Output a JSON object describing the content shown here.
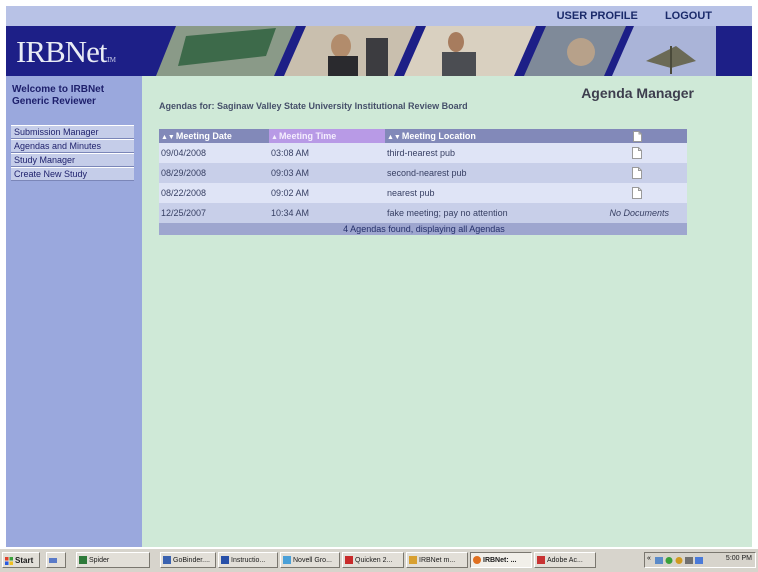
{
  "header": {
    "nav": [
      "USER PROFILE",
      "LOGOUT"
    ],
    "logo": "IRBNet",
    "logo_tm": "TM"
  },
  "sidebar": {
    "welcome_line1": "Welcome to IRBNet",
    "welcome_line2": "Generic Reviewer",
    "menu": [
      "Submission Manager",
      "Agendas and Minutes",
      "Study Manager",
      "Create New Study"
    ]
  },
  "main": {
    "title": "Agenda Manager",
    "agendas_for": "Agendas for: Saginaw Valley State University Institutional Review Board",
    "table": {
      "columns": [
        "Meeting Date",
        "Meeting Time",
        "Meeting Location",
        ""
      ],
      "sorted_column": 1,
      "rows": [
        {
          "date": "09/04/2008",
          "time": "03:08 AM",
          "location": "third-nearest pub",
          "docs": ""
        },
        {
          "date": "08/29/2008",
          "time": "09:03 AM",
          "location": "second-nearest pub",
          "docs": ""
        },
        {
          "date": "08/22/2008",
          "time": "09:02 AM",
          "location": "nearest pub",
          "docs": ""
        },
        {
          "date": "12/25/2007",
          "time": "10:34 AM",
          "location": "fake meeting; pay no attention",
          "docs": "No Documents"
        }
      ],
      "footer": "4 Agendas found, displaying all Agendas"
    }
  },
  "taskbar": {
    "start": "Start",
    "buttons": [
      "Spider",
      "GoBinder....",
      "Instructio...",
      "Novell Gro...",
      "Quicken 2...",
      "IRBNet m...",
      "IRBNet: ...",
      "Adobe Ac..."
    ],
    "active_index": 6,
    "time": "5:00 PM"
  },
  "colors": {
    "page_bg": "#cfe9d7",
    "sidebar": "#9aa8dd",
    "banner": "#1d1f87",
    "header_bar": "#b8c2e6",
    "table_header": "#8289b9",
    "sorted_header": "#b89ae6"
  }
}
